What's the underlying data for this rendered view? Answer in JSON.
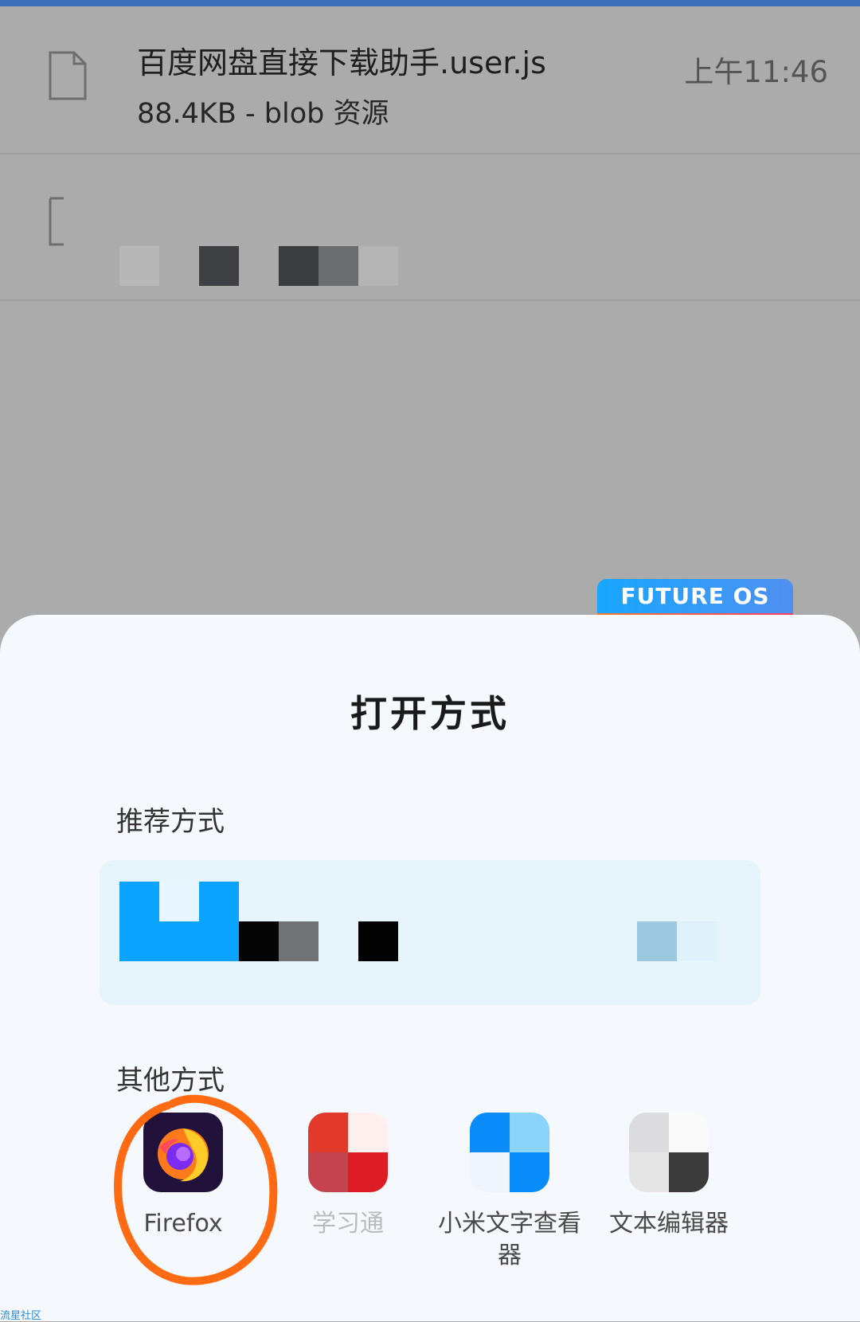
{
  "downloads": [
    {
      "name": "百度网盘直接下载助手.user.js",
      "meta": "88.4KB -  blob 资源",
      "time": "上午11:46",
      "icon": "file-icon"
    },
    {
      "name": "",
      "meta": "",
      "time": "",
      "icon": "file-icon"
    }
  ],
  "badge": {
    "label": "FUTURE  OS"
  },
  "sheet": {
    "title": "打开方式",
    "recommended_label": "推荐方式",
    "other_label": "其他方式",
    "apps": [
      {
        "label": "Firefox",
        "icon": "firefox-icon"
      },
      {
        "label": "学习通",
        "icon": "xuexitong-icon"
      },
      {
        "label": "小米文字查看器",
        "icon": "mi-text-viewer-icon"
      },
      {
        "label": "文本编辑器",
        "icon": "text-editor-icon"
      }
    ]
  },
  "colors": {
    "accent_line": "#3a6fb8",
    "backdrop": "#ababab",
    "sheet_bg": "#f5f8fc",
    "highlight": "#ff6a13"
  },
  "watermark": "流星社区"
}
